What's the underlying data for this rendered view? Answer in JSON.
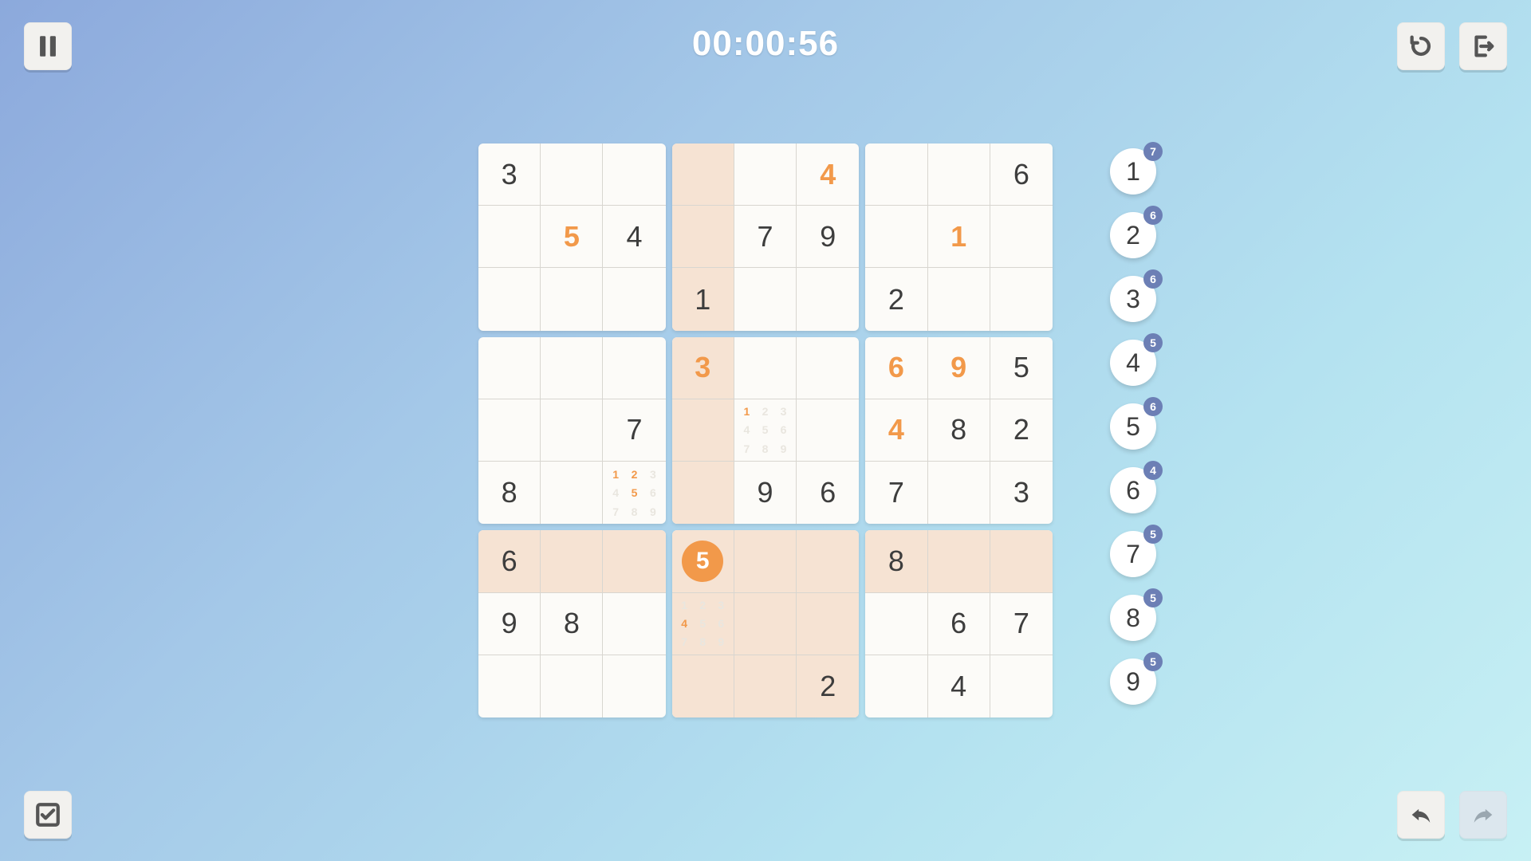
{
  "timer": "00:00:56",
  "selected": {
    "row": 6,
    "col": 3
  },
  "grid": [
    [
      {
        "v": "3",
        "t": "given"
      },
      {
        "v": "",
        "t": ""
      },
      {
        "v": "",
        "t": ""
      },
      {
        "v": "",
        "t": ""
      },
      {
        "v": "",
        "t": ""
      },
      {
        "v": "4",
        "t": "user"
      },
      {
        "v": "",
        "t": ""
      },
      {
        "v": "",
        "t": ""
      },
      {
        "v": "6",
        "t": "given"
      }
    ],
    [
      {
        "v": "",
        "t": ""
      },
      {
        "v": "5",
        "t": "user"
      },
      {
        "v": "4",
        "t": "given"
      },
      {
        "v": "",
        "t": ""
      },
      {
        "v": "7",
        "t": "given"
      },
      {
        "v": "9",
        "t": "given"
      },
      {
        "v": "",
        "t": ""
      },
      {
        "v": "1",
        "t": "user"
      },
      {
        "v": "",
        "t": ""
      }
    ],
    [
      {
        "v": "",
        "t": ""
      },
      {
        "v": "",
        "t": ""
      },
      {
        "v": "",
        "t": ""
      },
      {
        "v": "1",
        "t": "given"
      },
      {
        "v": "",
        "t": ""
      },
      {
        "v": "",
        "t": ""
      },
      {
        "v": "2",
        "t": "given"
      },
      {
        "v": "",
        "t": ""
      },
      {
        "v": "",
        "t": ""
      }
    ],
    [
      {
        "v": "",
        "t": ""
      },
      {
        "v": "",
        "t": ""
      },
      {
        "v": "",
        "t": ""
      },
      {
        "v": "3",
        "t": "user"
      },
      {
        "v": "",
        "t": ""
      },
      {
        "v": "",
        "t": ""
      },
      {
        "v": "6",
        "t": "user"
      },
      {
        "v": "9",
        "t": "user"
      },
      {
        "v": "5",
        "t": "given"
      }
    ],
    [
      {
        "v": "",
        "t": ""
      },
      {
        "v": "",
        "t": ""
      },
      {
        "v": "7",
        "t": "given"
      },
      {
        "v": "",
        "t": ""
      },
      {
        "v": "",
        "t": "pm",
        "pm": [
          1
        ]
      },
      {
        "v": "",
        "t": ""
      },
      {
        "v": "4",
        "t": "user"
      },
      {
        "v": "8",
        "t": "given"
      },
      {
        "v": "2",
        "t": "given"
      }
    ],
    [
      {
        "v": "8",
        "t": "given"
      },
      {
        "v": "",
        "t": ""
      },
      {
        "v": "",
        "t": "pm",
        "pm": [
          1,
          2,
          5
        ]
      },
      {
        "v": "",
        "t": ""
      },
      {
        "v": "9",
        "t": "given"
      },
      {
        "v": "6",
        "t": "given"
      },
      {
        "v": "7",
        "t": "given"
      },
      {
        "v": "",
        "t": ""
      },
      {
        "v": "3",
        "t": "given"
      }
    ],
    [
      {
        "v": "6",
        "t": "given"
      },
      {
        "v": "",
        "t": ""
      },
      {
        "v": "",
        "t": ""
      },
      {
        "v": "5",
        "t": "user-sel"
      },
      {
        "v": "",
        "t": ""
      },
      {
        "v": "",
        "t": ""
      },
      {
        "v": "8",
        "t": "given"
      },
      {
        "v": "",
        "t": ""
      },
      {
        "v": "",
        "t": ""
      }
    ],
    [
      {
        "v": "9",
        "t": "given"
      },
      {
        "v": "8",
        "t": "given"
      },
      {
        "v": "",
        "t": ""
      },
      {
        "v": "",
        "t": "pm",
        "pm": [
          4
        ]
      },
      {
        "v": "",
        "t": ""
      },
      {
        "v": "",
        "t": ""
      },
      {
        "v": "",
        "t": ""
      },
      {
        "v": "6",
        "t": "given"
      },
      {
        "v": "7",
        "t": "given"
      }
    ],
    [
      {
        "v": "",
        "t": ""
      },
      {
        "v": "",
        "t": ""
      },
      {
        "v": "",
        "t": ""
      },
      {
        "v": "",
        "t": ""
      },
      {
        "v": "",
        "t": ""
      },
      {
        "v": "2",
        "t": "given"
      },
      {
        "v": "",
        "t": ""
      },
      {
        "v": "4",
        "t": "given"
      },
      {
        "v": "",
        "t": ""
      }
    ]
  ],
  "picker": [
    {
      "n": "1",
      "remaining": "7"
    },
    {
      "n": "2",
      "remaining": "6"
    },
    {
      "n": "3",
      "remaining": "6"
    },
    {
      "n": "4",
      "remaining": "5"
    },
    {
      "n": "5",
      "remaining": "6"
    },
    {
      "n": "6",
      "remaining": "4"
    },
    {
      "n": "7",
      "remaining": "5"
    },
    {
      "n": "8",
      "remaining": "5"
    },
    {
      "n": "9",
      "remaining": "5"
    }
  ]
}
